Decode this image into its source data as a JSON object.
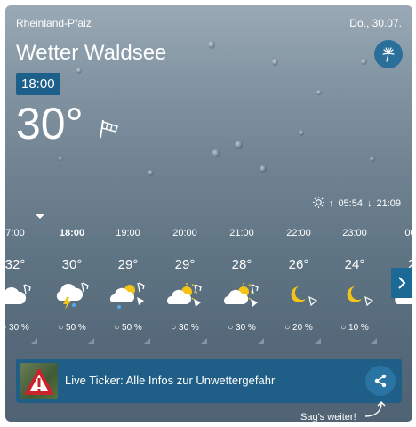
{
  "header": {
    "region": "Rheinland-Pfalz",
    "date": "Do., 30.07.",
    "title": "Wetter Waldsee"
  },
  "current": {
    "time": "18:00",
    "temperature": "30°",
    "sunrise": "05:54",
    "sunset": "21:09"
  },
  "hours": [
    {
      "hour": "7:00",
      "temp": "32°",
      "icon": "cloudy-wind-icon",
      "precip": "30 %"
    },
    {
      "hour": "18:00",
      "temp": "30°",
      "icon": "thunderstorm-icon",
      "precip": "50 %"
    },
    {
      "hour": "19:00",
      "temp": "29°",
      "icon": "partly-sunny-rain-icon",
      "precip": "50 %"
    },
    {
      "hour": "20:00",
      "temp": "29°",
      "icon": "partly-sunny-icon",
      "precip": "30 %"
    },
    {
      "hour": "21:00",
      "temp": "28°",
      "icon": "partly-sunny-icon",
      "precip": "30 %"
    },
    {
      "hour": "22:00",
      "temp": "26°",
      "icon": "moon-icon",
      "precip": "20 %"
    },
    {
      "hour": "23:00",
      "temp": "24°",
      "icon": "moon-icon",
      "precip": "10 %"
    },
    {
      "hour": "00:",
      "temp": "2",
      "icon": "cloud-icon",
      "precip": ""
    }
  ],
  "ticker": {
    "label": "Live Ticker: Alle Infos zur Unwettergefahr"
  },
  "share_hint": "Sag's weiter!",
  "colors": {
    "accent": "#1b5f8a",
    "ticker_bg": "#1e5e87"
  }
}
